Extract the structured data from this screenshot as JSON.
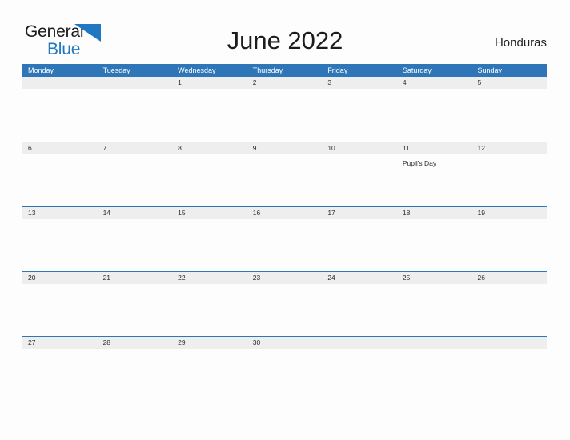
{
  "brand": {
    "name_part1": "General",
    "name_part2": "Blue",
    "flag_icon": "blue-triangle-flag",
    "color_primary": "#1f78c1",
    "color_dark": "#1b1b1b"
  },
  "header": {
    "title": "June 2022",
    "country": "Honduras"
  },
  "theme": {
    "header_blue": "#2e76b8",
    "band_gray": "#eeeeee",
    "page_background": "#fdfdfd",
    "text_dark": "#2b2b2b"
  },
  "calendar": {
    "month": "June",
    "year": "2022",
    "weekday_headers": [
      "Monday",
      "Tuesday",
      "Wednesday",
      "Thursday",
      "Friday",
      "Saturday",
      "Sunday"
    ],
    "weeks": [
      {
        "days": [
          {
            "date": "",
            "events": []
          },
          {
            "date": "",
            "events": []
          },
          {
            "date": "1",
            "events": []
          },
          {
            "date": "2",
            "events": []
          },
          {
            "date": "3",
            "events": []
          },
          {
            "date": "4",
            "events": []
          },
          {
            "date": "5",
            "events": []
          }
        ]
      },
      {
        "days": [
          {
            "date": "6",
            "events": []
          },
          {
            "date": "7",
            "events": []
          },
          {
            "date": "8",
            "events": []
          },
          {
            "date": "9",
            "events": []
          },
          {
            "date": "10",
            "events": []
          },
          {
            "date": "11",
            "events": [
              "Pupil's Day"
            ]
          },
          {
            "date": "12",
            "events": []
          }
        ]
      },
      {
        "days": [
          {
            "date": "13",
            "events": []
          },
          {
            "date": "14",
            "events": []
          },
          {
            "date": "15",
            "events": []
          },
          {
            "date": "16",
            "events": []
          },
          {
            "date": "17",
            "events": []
          },
          {
            "date": "18",
            "events": []
          },
          {
            "date": "19",
            "events": []
          }
        ]
      },
      {
        "days": [
          {
            "date": "20",
            "events": []
          },
          {
            "date": "21",
            "events": []
          },
          {
            "date": "22",
            "events": []
          },
          {
            "date": "23",
            "events": []
          },
          {
            "date": "24",
            "events": []
          },
          {
            "date": "25",
            "events": []
          },
          {
            "date": "26",
            "events": []
          }
        ]
      },
      {
        "days": [
          {
            "date": "27",
            "events": []
          },
          {
            "date": "28",
            "events": []
          },
          {
            "date": "29",
            "events": []
          },
          {
            "date": "30",
            "events": []
          },
          {
            "date": "",
            "events": []
          },
          {
            "date": "",
            "events": []
          },
          {
            "date": "",
            "events": []
          }
        ]
      }
    ]
  }
}
